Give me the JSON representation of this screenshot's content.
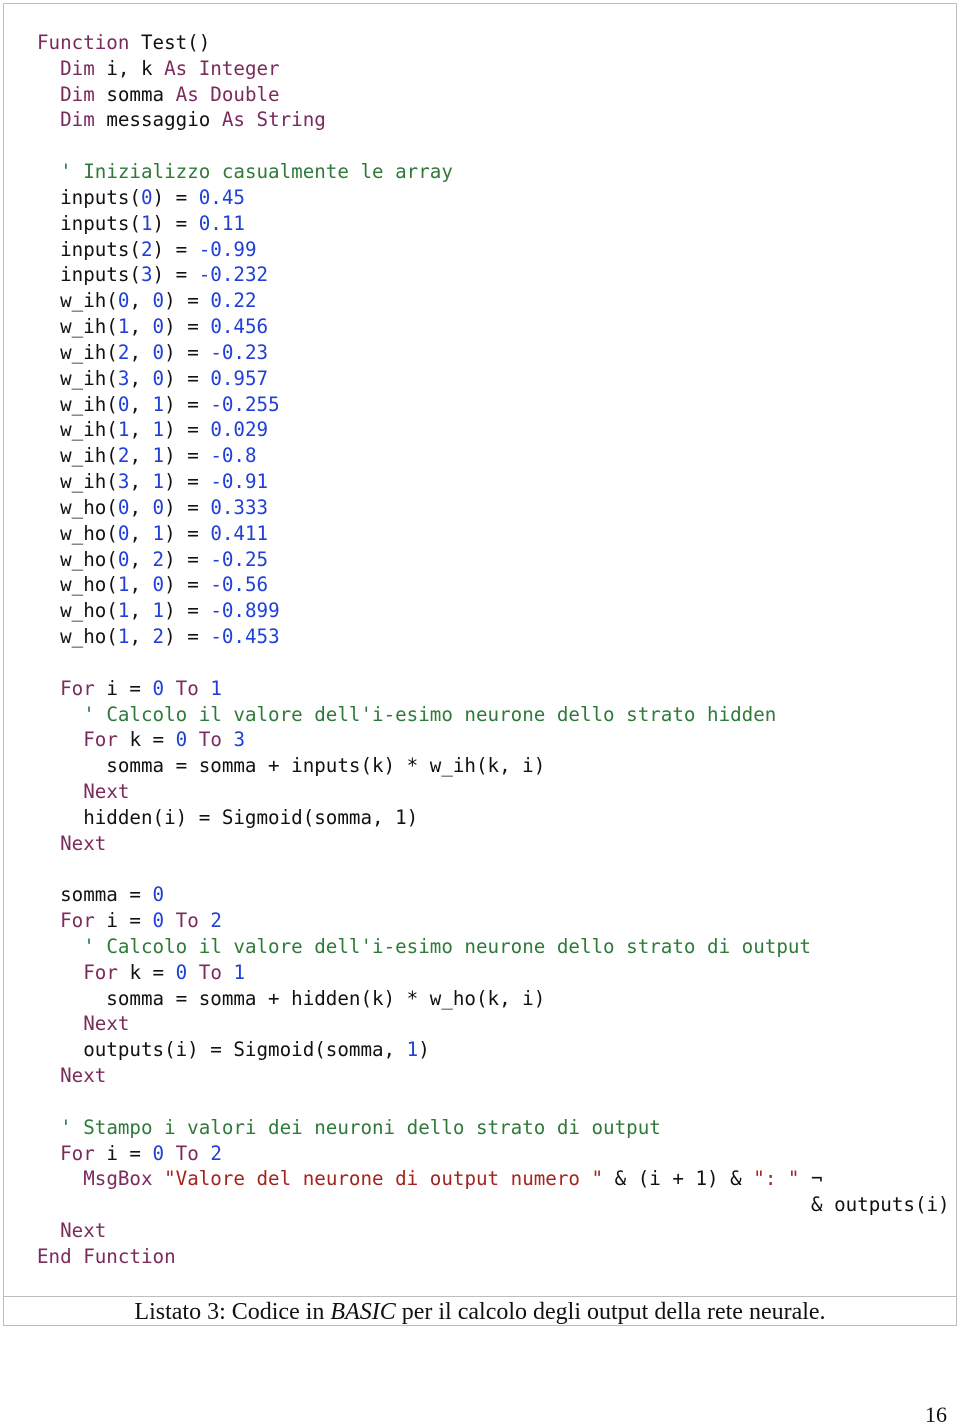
{
  "colors": {
    "keyword": "#7b2a5c",
    "number": "#1f3fd6",
    "comment": "#2f7a3a",
    "string": "#a3231f",
    "plain": "#111111"
  },
  "code": {
    "lines": [
      [
        [
          "k",
          "Function "
        ],
        [
          "p",
          "Test()"
        ]
      ],
      [
        [
          "p",
          "  "
        ],
        [
          "k",
          "Dim "
        ],
        [
          "p",
          "i, k "
        ],
        [
          "k",
          "As Integer"
        ]
      ],
      [
        [
          "p",
          "  "
        ],
        [
          "k",
          "Dim "
        ],
        [
          "p",
          "somma "
        ],
        [
          "k",
          "As Double"
        ]
      ],
      [
        [
          "p",
          "  "
        ],
        [
          "k",
          "Dim "
        ],
        [
          "p",
          "messaggio "
        ],
        [
          "k",
          "As String"
        ]
      ],
      [],
      [
        [
          "p",
          "  "
        ],
        [
          "c",
          "' Inizializzo casualmente le array"
        ]
      ],
      [
        [
          "p",
          "  inputs("
        ],
        [
          "n",
          "0"
        ],
        [
          "p",
          ") = "
        ],
        [
          "n",
          "0.45"
        ]
      ],
      [
        [
          "p",
          "  inputs("
        ],
        [
          "n",
          "1"
        ],
        [
          "p",
          ") = "
        ],
        [
          "n",
          "0.11"
        ]
      ],
      [
        [
          "p",
          "  inputs("
        ],
        [
          "n",
          "2"
        ],
        [
          "p",
          ") = "
        ],
        [
          "n",
          "-0.99"
        ]
      ],
      [
        [
          "p",
          "  inputs("
        ],
        [
          "n",
          "3"
        ],
        [
          "p",
          ") = "
        ],
        [
          "n",
          "-0.232"
        ]
      ],
      [
        [
          "p",
          "  w_ih("
        ],
        [
          "n",
          "0"
        ],
        [
          "p",
          ", "
        ],
        [
          "n",
          "0"
        ],
        [
          "p",
          ") = "
        ],
        [
          "n",
          "0.22"
        ]
      ],
      [
        [
          "p",
          "  w_ih("
        ],
        [
          "n",
          "1"
        ],
        [
          "p",
          ", "
        ],
        [
          "n",
          "0"
        ],
        [
          "p",
          ") = "
        ],
        [
          "n",
          "0.456"
        ]
      ],
      [
        [
          "p",
          "  w_ih("
        ],
        [
          "n",
          "2"
        ],
        [
          "p",
          ", "
        ],
        [
          "n",
          "0"
        ],
        [
          "p",
          ") = "
        ],
        [
          "n",
          "-0.23"
        ]
      ],
      [
        [
          "p",
          "  w_ih("
        ],
        [
          "n",
          "3"
        ],
        [
          "p",
          ", "
        ],
        [
          "n",
          "0"
        ],
        [
          "p",
          ") = "
        ],
        [
          "n",
          "0.957"
        ]
      ],
      [
        [
          "p",
          "  w_ih("
        ],
        [
          "n",
          "0"
        ],
        [
          "p",
          ", "
        ],
        [
          "n",
          "1"
        ],
        [
          "p",
          ") = "
        ],
        [
          "n",
          "-0.255"
        ]
      ],
      [
        [
          "p",
          "  w_ih("
        ],
        [
          "n",
          "1"
        ],
        [
          "p",
          ", "
        ],
        [
          "n",
          "1"
        ],
        [
          "p",
          ") = "
        ],
        [
          "n",
          "0.029"
        ]
      ],
      [
        [
          "p",
          "  w_ih("
        ],
        [
          "n",
          "2"
        ],
        [
          "p",
          ", "
        ],
        [
          "n",
          "1"
        ],
        [
          "p",
          ") = "
        ],
        [
          "n",
          "-0.8"
        ]
      ],
      [
        [
          "p",
          "  w_ih("
        ],
        [
          "n",
          "3"
        ],
        [
          "p",
          ", "
        ],
        [
          "n",
          "1"
        ],
        [
          "p",
          ") = "
        ],
        [
          "n",
          "-0.91"
        ]
      ],
      [
        [
          "p",
          "  w_ho("
        ],
        [
          "n",
          "0"
        ],
        [
          "p",
          ", "
        ],
        [
          "n",
          "0"
        ],
        [
          "p",
          ") = "
        ],
        [
          "n",
          "0.333"
        ]
      ],
      [
        [
          "p",
          "  w_ho("
        ],
        [
          "n",
          "0"
        ],
        [
          "p",
          ", "
        ],
        [
          "n",
          "1"
        ],
        [
          "p",
          ") = "
        ],
        [
          "n",
          "0.411"
        ]
      ],
      [
        [
          "p",
          "  w_ho("
        ],
        [
          "n",
          "0"
        ],
        [
          "p",
          ", "
        ],
        [
          "n",
          "2"
        ],
        [
          "p",
          ") = "
        ],
        [
          "n",
          "-0.25"
        ]
      ],
      [
        [
          "p",
          "  w_ho("
        ],
        [
          "n",
          "1"
        ],
        [
          "p",
          ", "
        ],
        [
          "n",
          "0"
        ],
        [
          "p",
          ") = "
        ],
        [
          "n",
          "-0.56"
        ]
      ],
      [
        [
          "p",
          "  w_ho("
        ],
        [
          "n",
          "1"
        ],
        [
          "p",
          ", "
        ],
        [
          "n",
          "1"
        ],
        [
          "p",
          ") = "
        ],
        [
          "n",
          "-0.899"
        ]
      ],
      [
        [
          "p",
          "  w_ho("
        ],
        [
          "n",
          "1"
        ],
        [
          "p",
          ", "
        ],
        [
          "n",
          "2"
        ],
        [
          "p",
          ") = "
        ],
        [
          "n",
          "-0.453"
        ]
      ],
      [],
      [
        [
          "p",
          "  "
        ],
        [
          "k",
          "For "
        ],
        [
          "p",
          "i = "
        ],
        [
          "n",
          "0"
        ],
        [
          "k",
          " To "
        ],
        [
          "n",
          "1"
        ]
      ],
      [
        [
          "p",
          "    "
        ],
        [
          "c",
          "' Calcolo il valore dell'i-esimo neurone dello strato hidden"
        ]
      ],
      [
        [
          "p",
          "    "
        ],
        [
          "k",
          "For "
        ],
        [
          "p",
          "k = "
        ],
        [
          "n",
          "0"
        ],
        [
          "k",
          " To "
        ],
        [
          "n",
          "3"
        ]
      ],
      [
        [
          "p",
          "      somma = somma + inputs(k) * w_ih(k, i)"
        ]
      ],
      [
        [
          "p",
          "    "
        ],
        [
          "k",
          "Next"
        ]
      ],
      [
        [
          "p",
          "    hidden(i) = Sigmoid(somma, 1)"
        ]
      ],
      [
        [
          "p",
          "  "
        ],
        [
          "k",
          "Next"
        ]
      ],
      [],
      [
        [
          "p",
          "  somma = "
        ],
        [
          "n",
          "0"
        ]
      ],
      [
        [
          "p",
          "  "
        ],
        [
          "k",
          "For "
        ],
        [
          "p",
          "i = "
        ],
        [
          "n",
          "0"
        ],
        [
          "k",
          " To "
        ],
        [
          "n",
          "2"
        ]
      ],
      [
        [
          "p",
          "    "
        ],
        [
          "c",
          "' Calcolo il valore dell'i-esimo neurone dello strato di output"
        ]
      ],
      [
        [
          "p",
          "    "
        ],
        [
          "k",
          "For "
        ],
        [
          "p",
          "k = "
        ],
        [
          "n",
          "0"
        ],
        [
          "k",
          " To "
        ],
        [
          "n",
          "1"
        ]
      ],
      [
        [
          "p",
          "      somma = somma + hidden(k) * w_ho(k, i)"
        ]
      ],
      [
        [
          "p",
          "    "
        ],
        [
          "k",
          "Next"
        ]
      ],
      [
        [
          "p",
          "    outputs(i) = Sigmoid(somma, "
        ],
        [
          "n",
          "1"
        ],
        [
          "p",
          ")"
        ]
      ],
      [
        [
          "p",
          "  "
        ],
        [
          "k",
          "Next"
        ]
      ],
      [],
      [
        [
          "p",
          "  "
        ],
        [
          "c",
          "' Stampo i valori dei neuroni dello strato di output"
        ]
      ],
      [
        [
          "p",
          "  "
        ],
        [
          "k",
          "For "
        ],
        [
          "p",
          "i = "
        ],
        [
          "n",
          "0"
        ],
        [
          "k",
          " To "
        ],
        [
          "n",
          "2"
        ]
      ],
      [
        [
          "p",
          "    "
        ],
        [
          "k",
          "MsgBox "
        ],
        [
          "s",
          "\"Valore del neurone di output numero \""
        ],
        [
          "p",
          " & (i + 1) & "
        ],
        [
          "s",
          "\": \""
        ],
        [
          "p",
          " ¬"
        ]
      ],
      [
        [
          "p",
          "                                                                   & outputs(i)"
        ]
      ],
      [
        [
          "p",
          "  "
        ],
        [
          "k",
          "Next"
        ]
      ],
      [
        [
          "k",
          "End Function"
        ]
      ]
    ]
  },
  "caption": {
    "prefix": "Listato 3: Codice in ",
    "emph": "BASIC",
    "suffix": " per il calcolo degli output della rete neurale."
  },
  "page_number": "16"
}
